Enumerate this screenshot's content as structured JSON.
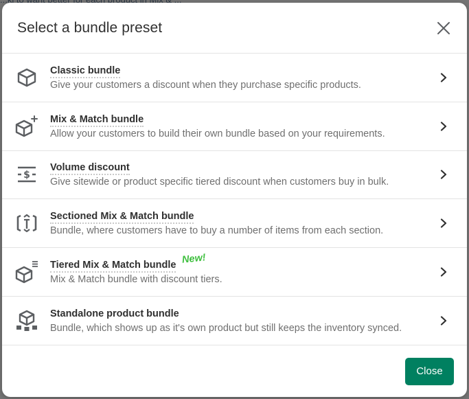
{
  "backdrop": {
    "partial_text": "...ki to want better for each product in Mix & ..."
  },
  "modal": {
    "title": "Select a bundle preset",
    "close_icon": "close-icon",
    "items": [
      {
        "icon": "box-icon",
        "title": "Classic bundle",
        "description": "Give your customers a discount when they purchase specific products.",
        "badge": null
      },
      {
        "icon": "box-plus-icon",
        "title": "Mix & Match bundle",
        "description": "Allow your customers to build their own bundle based on your requirements.",
        "badge": null
      },
      {
        "icon": "dollar-discount-icon",
        "title": "Volume discount",
        "description": "Give sitewide or product specific tiered discount when customers buy in bulk.",
        "badge": null
      },
      {
        "icon": "sectioned-bracket-icon",
        "title": "Sectioned Mix & Match bundle",
        "description": "Bundle, where customers have to buy a number of items from each section.",
        "badge": null
      },
      {
        "icon": "box-tiers-icon",
        "title": "Tiered Mix & Match bundle",
        "description": "Mix & Match bundle with discount tiers.",
        "badge": "New!"
      },
      {
        "icon": "box-network-icon",
        "title": "Standalone product bundle",
        "description": "Bundle, which shows up as it's own product but still keeps the inventory synced.",
        "badge": null
      }
    ],
    "footer": {
      "close_label": "Close"
    }
  },
  "colors": {
    "primary": "#008060",
    "new_badge": "#3fbf3f",
    "title_text": "#303030",
    "desc_text": "#6f6f6f",
    "icon": "#5c5f62",
    "divider": "#e3e3e3"
  }
}
